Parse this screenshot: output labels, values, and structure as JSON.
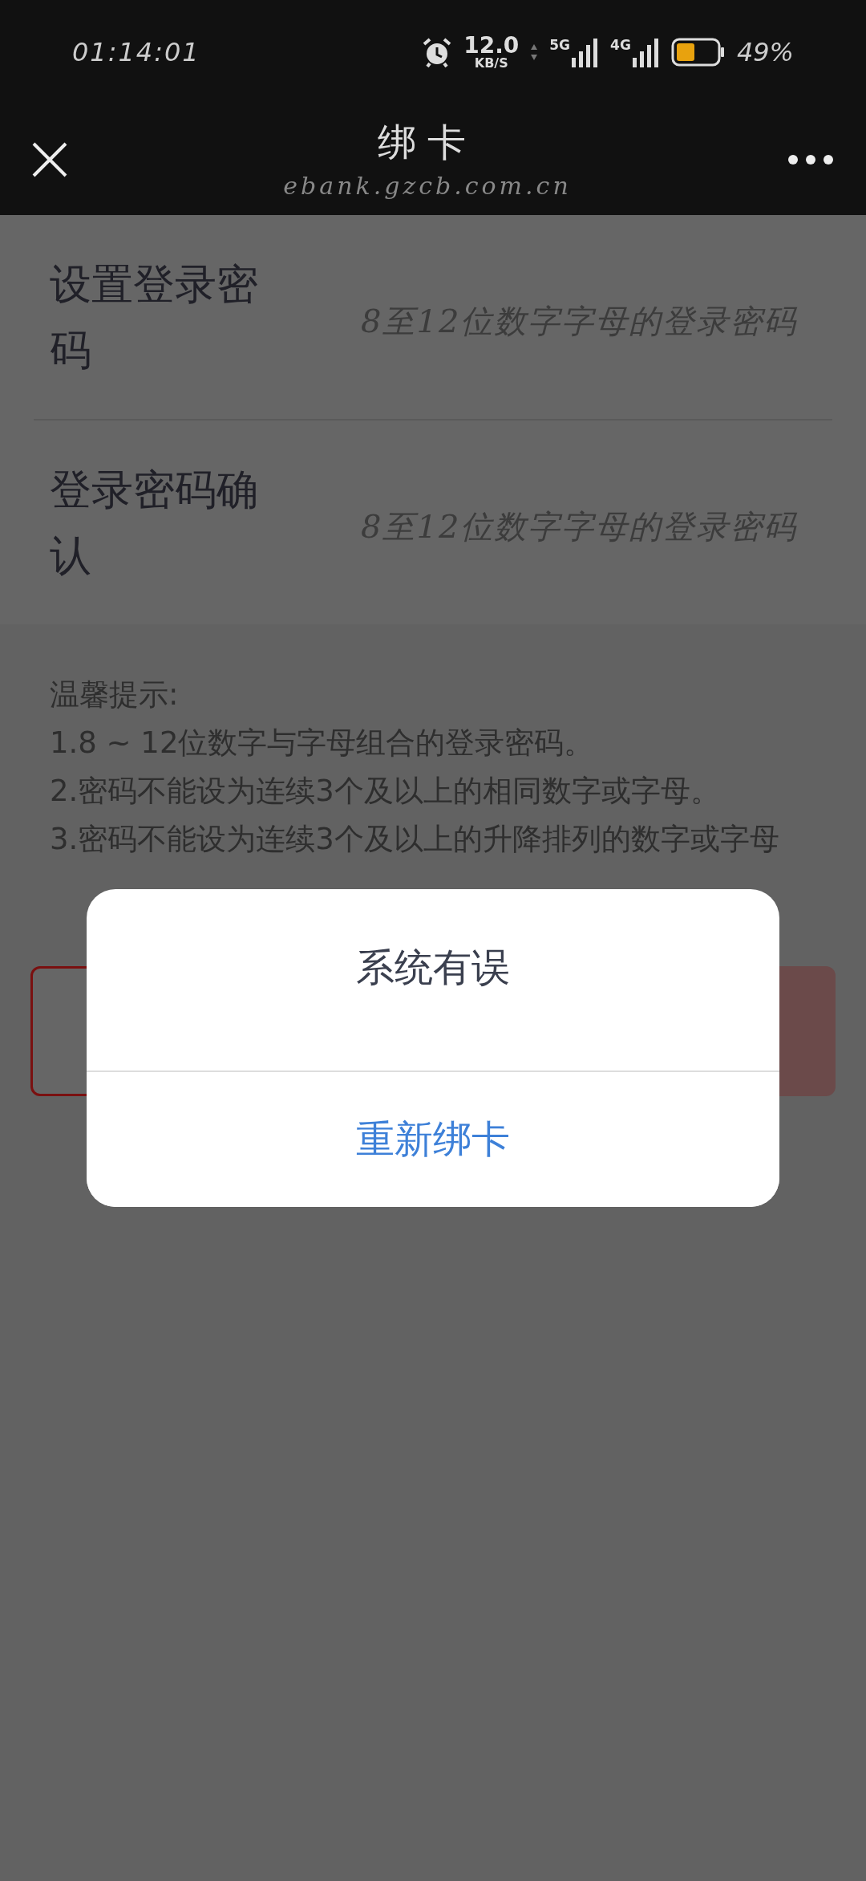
{
  "status_bar": {
    "time": "01:14:01",
    "speed": "12.0",
    "speed_unit": "KB/S",
    "network_primary": "5G",
    "network_secondary": "4G",
    "battery": "49%"
  },
  "header": {
    "title": "绑卡",
    "subtitle": "ebank.gzcb.com.cn"
  },
  "fields": [
    {
      "label": "设置登录密码",
      "placeholder": "8至12位数字字母的登录密码"
    },
    {
      "label": "登录密码确认",
      "placeholder": "8至12位数字字母的登录密码"
    }
  ],
  "tips": {
    "title": "温馨提示:",
    "lines": [
      "1.8 ~ 12位数字与字母组合的登录密码。",
      "2.密码不能设为连续3个及以上的相同数字或字母。",
      "3.密码不能设为连续3个及以上的升降排列的数字或字母"
    ]
  },
  "buttons": [
    {
      "kind": "outline"
    },
    {
      "kind": "filled"
    }
  ],
  "dialog": {
    "message": "系统有误",
    "action": "重新绑卡"
  }
}
